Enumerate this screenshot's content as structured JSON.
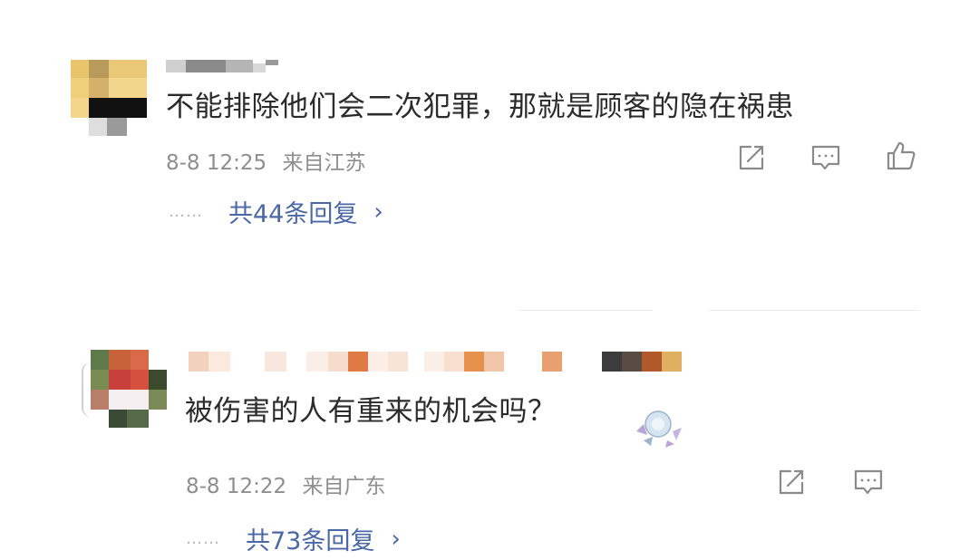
{
  "comments": [
    {
      "text": "不能排除他们会二次犯罪，那就是顾客的隐在祸患",
      "time": "8-8 12:25",
      "location": "来自江苏",
      "replies_label": "共44条回复",
      "actions": [
        "share-icon",
        "comment-icon",
        "like-icon"
      ]
    },
    {
      "text": "被伤害的人有重来的机会吗？",
      "time": "8-8 12:22",
      "location": "来自广东",
      "replies_label": "共73条回复",
      "actions": [
        "share-icon",
        "comment-icon"
      ]
    }
  ],
  "replies_dots": "……",
  "colors": {
    "text": "#2b2b2b",
    "meta": "#8e8e8e",
    "link": "#4a67a8"
  }
}
